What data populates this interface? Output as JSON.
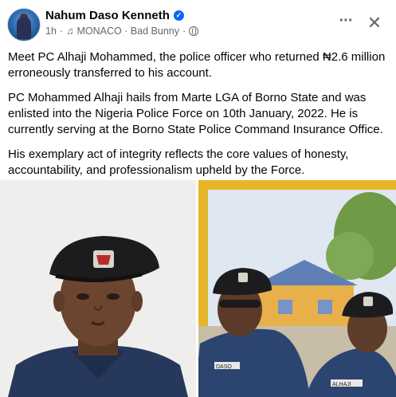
{
  "post": {
    "author": "Nahum Daso Kenneth",
    "time": "1h",
    "separator": "·",
    "music_note": "♫",
    "music": "MONACO · Bad Bunny",
    "verified_icon": "verified-badge-icon",
    "paragraphs": [
      "Meet PC Alhaji Mohammed, the police officer who returned ₦2.6 million erroneously transferred to his account.",
      "PC Mohammed Alhaji hails from Marte LGA of Borno State and was enlisted into the Nigeria Police Force on 10th January, 2022. He is currently serving at the Borno State Police Command Insurance Office.",
      "His exemplary act of integrity reflects the core values of honesty, accountability, and professionalism upheld by the Force."
    ],
    "more_label": "···",
    "close_label": "✕",
    "name_tags": [
      "DASO",
      "ALHAJI"
    ]
  },
  "colors": {
    "accent": "#0866ff",
    "meta_text": "#65676b",
    "uniform": "#2b3f66",
    "beret": "#1c1c1f"
  }
}
